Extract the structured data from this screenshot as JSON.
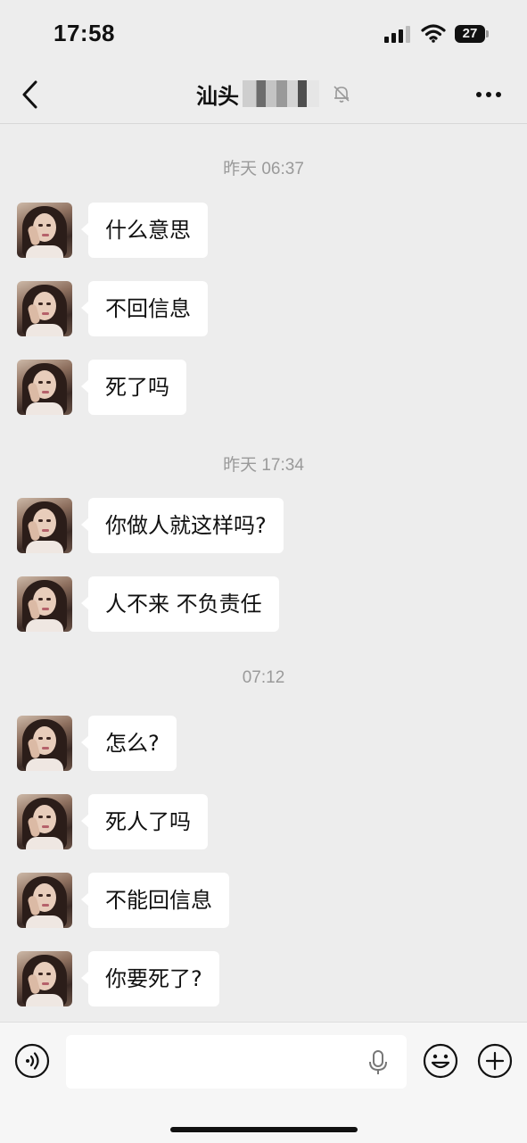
{
  "status_bar": {
    "time": "17:58",
    "battery": "27"
  },
  "header": {
    "title": "汕头",
    "back_icon": "chevron-left-icon",
    "mute_icon": "bell-muted-icon",
    "more_icon": "more-dots-icon"
  },
  "conversation": {
    "groups": [
      {
        "timestamp": "昨天 06:37",
        "messages": [
          "什么意思",
          "不回信息",
          "死了吗"
        ]
      },
      {
        "timestamp": "昨天 17:34",
        "messages": [
          "你做人就这样吗?",
          "人不来 不负责任"
        ]
      },
      {
        "timestamp": "07:12",
        "messages": [
          "怎么?",
          "死人了吗",
          "不能回信息",
          "你要死了?"
        ]
      }
    ]
  },
  "input_bar": {
    "value": "",
    "voice_icon": "voice-wave-icon",
    "mic_icon": "microphone-icon",
    "emoji_icon": "emoji-icon",
    "plus_icon": "plus-circle-icon"
  },
  "colors": {
    "background": "#ededed",
    "bubble": "#ffffff",
    "timestamp": "#9a9a9a"
  }
}
